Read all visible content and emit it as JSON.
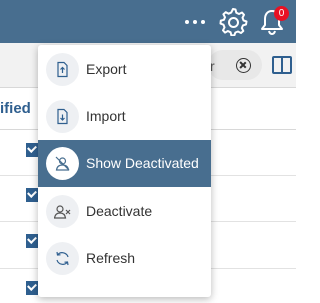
{
  "header": {
    "notification_count": "0",
    "icons": [
      "more-icon",
      "gear-icon",
      "bell-icon"
    ]
  },
  "toolbar": {
    "search_fragment": "r"
  },
  "table": {
    "column_header_fragment": "ified"
  },
  "menu": {
    "items": [
      {
        "label": "Export",
        "icon": "export-icon",
        "active": false
      },
      {
        "label": "Import",
        "icon": "import-icon",
        "active": false
      },
      {
        "label": "Show Deactivated",
        "icon": "show-deactivated-icon",
        "active": true
      },
      {
        "label": "Deactivate",
        "icon": "deactivate-user-icon",
        "active": false
      },
      {
        "label": "Refresh",
        "icon": "refresh-icon",
        "active": false
      }
    ]
  },
  "colors": {
    "header_bg": "#486e8f",
    "active_item_bg": "#486e8f",
    "badge": "#e81123",
    "accent": "#2f5f8f"
  }
}
